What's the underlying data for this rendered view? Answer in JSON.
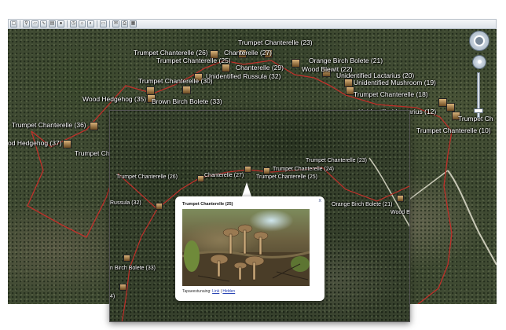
{
  "toolbar": {
    "buttons": [
      {
        "icon": "hand-icon"
      },
      {
        "icon": "placemark-icon"
      },
      {
        "icon": "polygon-icon"
      },
      {
        "icon": "path-icon"
      },
      {
        "icon": "overlay-icon"
      },
      {
        "icon": "tour-icon"
      },
      {
        "icon": "historical-imagery-icon"
      },
      {
        "icon": "sunlight-icon"
      },
      {
        "icon": "planets-icon"
      },
      {
        "icon": "ruler-icon"
      },
      {
        "icon": "email-icon"
      },
      {
        "icon": "print-icon"
      },
      {
        "icon": "view-in-maps-icon"
      }
    ]
  },
  "colors": {
    "track": "#c0302a",
    "label_text": "#ffffff",
    "road": "#c8c8b6",
    "popup_link": "#2a45b5"
  },
  "back_map": {
    "placemarks": [
      {
        "label": "Trumpet Chanterelle  (23)"
      },
      {
        "label": "Trumpet Chanterelle  (26)"
      },
      {
        "label": "Chanterelle  (27)"
      },
      {
        "label": "Trumpet Chanterelle  (25)"
      },
      {
        "label": "Chanterelle  (29)"
      },
      {
        "label": "Orange Birch Bolete  (21)"
      },
      {
        "label": "Wood Blewit  (22)"
      },
      {
        "label": "Unidentified Russula  (32)"
      },
      {
        "label": "Unidentified Lactarius  (20)"
      },
      {
        "label": "Unidentified Mushroom  (19)"
      },
      {
        "label": "Trumpet Chanterelle  (30)"
      },
      {
        "label": "Trumpet Chanterelle  (18)"
      },
      {
        "label": "Wood Hedgehog  (35)"
      },
      {
        "label": "Brown Birch Bolete  (33)"
      },
      {
        "label": "Unidentified Lactarius  (12)"
      },
      {
        "label": "Trumpet Ch"
      },
      {
        "label": "Trumpet Chanterelle  (36)"
      },
      {
        "label": "Trumpet Chanterelle  (10)"
      },
      {
        "label": "od Hedgehog  (37)"
      },
      {
        "label": "Trumpet Cha"
      }
    ]
  },
  "front_map": {
    "placemarks": [
      {
        "label": "Trumpet Chanterelle  (23)"
      },
      {
        "label": "Trumpet Chanterelle  (26)"
      },
      {
        "label": "Chanterelle  (27)"
      },
      {
        "label": "Trumpet Chanterelle  (24)"
      },
      {
        "label": "Trumpet Chanterelle  (25)"
      },
      {
        "label": "Russula  (32)"
      },
      {
        "label": "Orange Birch Bolete  (21)"
      },
      {
        "label": "Wood B"
      },
      {
        "label": "n Birch Bolete  (33)"
      },
      {
        "label": "4)"
      }
    ]
  },
  "popup": {
    "title": "Trumpet Chanterelle (25)",
    "close": "x",
    "caption_prefix": "Tapaeestunaing: ",
    "caption_link": "Link",
    "caption_separator": " | ",
    "caption_link_2": "Hidden"
  }
}
